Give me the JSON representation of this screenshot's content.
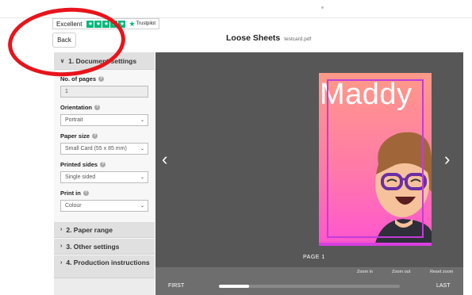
{
  "trustpilot": {
    "rating_text": "Excellent",
    "logo_text": "Trustpilot",
    "stars": 5
  },
  "header": {
    "back_label": "Back",
    "title": "Loose Sheets",
    "filename": "testcard.pdf"
  },
  "sidebar": {
    "section1": {
      "title": "1. Document settings",
      "fields": {
        "pages_label": "No. of pages",
        "pages_value": "1",
        "orientation_label": "Orientation",
        "orientation_value": "Portrait",
        "paper_label": "Paper size",
        "paper_value": "Small Card (55 x 85 mm)",
        "sides_label": "Printed sides",
        "sides_value": "Single sided",
        "print_label": "Print in",
        "print_value": "Colour"
      }
    },
    "section2": "2. Paper range",
    "section3": "3. Other settings",
    "section4": "4. Production instructions"
  },
  "viewer": {
    "card_name": "Maddy",
    "page_label": "PAGE 1",
    "zoom_in": "Zoom in",
    "zoom_out": "Zoom out",
    "reset_zoom": "Reset zoom",
    "first": "FIRST",
    "last": "LAST"
  },
  "colors": {
    "trustpilot_green": "#00b67a",
    "annotation_red": "#e8141b",
    "viewer_bg": "#575757"
  }
}
